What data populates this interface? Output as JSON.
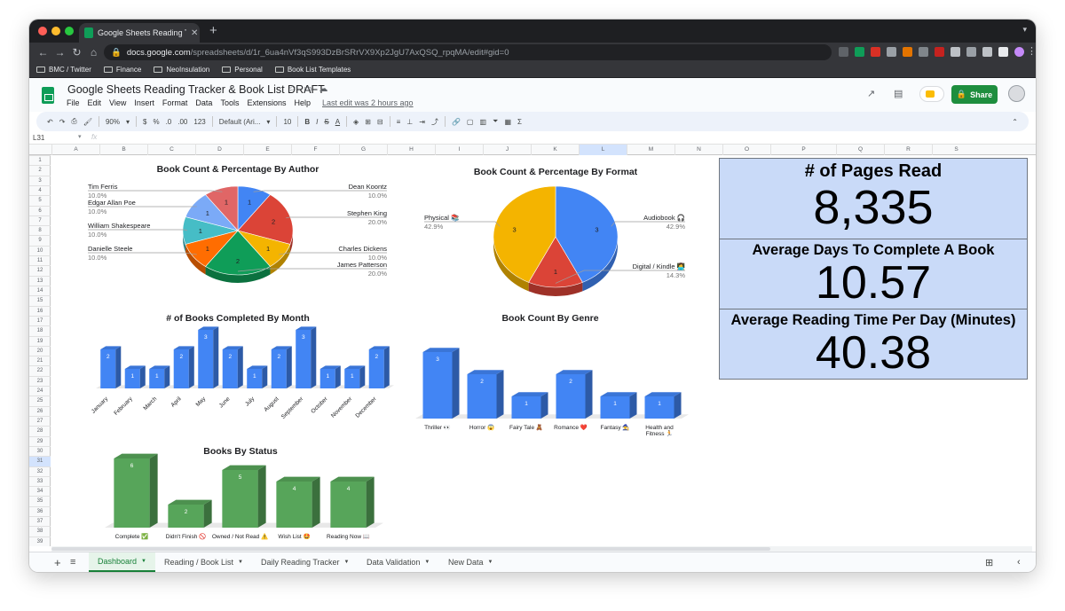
{
  "browser": {
    "tab_title": "Google Sheets Reading Tracker",
    "url_host": "docs.google.com",
    "url_path": "/spreadsheets/d/1r_6ua4nVf3qS993DzBrSRrVX9Xp2JgU7AxQSQ_rpqMA/edit#gid=0",
    "bookmarks": [
      "BMC / Twitter",
      "Finance",
      "NeoInsulation",
      "Personal",
      "Book List Templates"
    ]
  },
  "doc": {
    "title": "Google Sheets Reading Tracker & Book List DRAFT",
    "menus": [
      "File",
      "Edit",
      "View",
      "Insert",
      "Format",
      "Data",
      "Tools",
      "Extensions",
      "Help"
    ],
    "last_edit": "Last edit was 2 hours ago",
    "share_label": "Share"
  },
  "toolbar": {
    "zoom": "90%",
    "currency": "$",
    "percent": "%",
    "dec_decrease": ".0",
    "dec_increase": ".00",
    "format_more": "123",
    "font": "Default (Ari...",
    "font_size": "10"
  },
  "formula_bar": {
    "cell": "L31",
    "fx": "fx"
  },
  "columns": [
    "A",
    "B",
    "C",
    "D",
    "E",
    "F",
    "G",
    "H",
    "I",
    "J",
    "K",
    "L",
    "M",
    "N",
    "O",
    "P",
    "Q",
    "R",
    "S"
  ],
  "rows": [
    "1",
    "2",
    "3",
    "4",
    "5",
    "6",
    "7",
    "8",
    "9",
    "10",
    "11",
    "12",
    "13",
    "14",
    "15",
    "16",
    "17",
    "18",
    "19",
    "20",
    "21",
    "22",
    "23",
    "24",
    "25",
    "26",
    "27",
    "28",
    "29",
    "30",
    "31",
    "32",
    "33",
    "34",
    "35",
    "36",
    "37",
    "38",
    "39"
  ],
  "kpis": [
    {
      "label": "# of Pages Read",
      "value": "8,335"
    },
    {
      "label": "Average Days To Complete A Book",
      "value": "10.57"
    },
    {
      "label": "Average Reading Time Per Day (Minutes)",
      "value": "40.38"
    }
  ],
  "sheet_tabs": [
    "Dashboard",
    "Reading / Book List",
    "Daily Reading Tracker",
    "Data Validation",
    "New Data"
  ],
  "colors": {
    "blue": "#4285f4",
    "red": "#db4437",
    "yellow": "#f4b400",
    "green": "#0f9d58",
    "bar_green": "#57a55a",
    "kpi_bg": "#c9daf8",
    "share_green": "#1e8e3e"
  },
  "chart_data": [
    {
      "type": "pie",
      "title": "Book Count & Percentage By Author",
      "labels": [
        "Dean Koontz",
        "Stephen King",
        "Charles Dickens",
        "James Patterson",
        "Danielle Steele",
        "William Shakespeare",
        "Edgar Allan Poe",
        "Tim Ferris"
      ],
      "values": [
        1,
        2,
        1,
        2,
        1,
        1,
        1,
        1
      ],
      "percent_labels": [
        "10.0%",
        "20.0%",
        "10.0%",
        "20.0%",
        "10.0%",
        "10.0%",
        "10.0%",
        "10.0%"
      ],
      "colors": [
        "#4285f4",
        "#db4437",
        "#f4b400",
        "#0f9d58",
        "#ff6d01",
        "#46bdc6",
        "#7baaf7",
        "#e06666"
      ]
    },
    {
      "type": "pie",
      "title": "Book Count & Percentage By Format",
      "labels": [
        "Audiobook 🎧",
        "Digital / Kindle 👩‍💻",
        "Physical 📚"
      ],
      "values": [
        3,
        1,
        3
      ],
      "percent_labels": [
        "42.9%",
        "14.3%",
        "42.9%"
      ],
      "colors": [
        "#4285f4",
        "#db4437",
        "#f4b400"
      ]
    },
    {
      "type": "bar",
      "title": "# of Books Completed By Month",
      "categories": [
        "January",
        "February",
        "March",
        "April",
        "May",
        "June",
        "July",
        "August",
        "September",
        "October",
        "November",
        "December"
      ],
      "values": [
        2,
        1,
        1,
        2,
        3,
        2,
        1,
        2,
        3,
        1,
        1,
        2
      ],
      "color": "#4285f4"
    },
    {
      "type": "bar",
      "title": "Book Count By Genre",
      "categories": [
        "Thriller 👀",
        "Horror 😱",
        "Fairy Tale 🧸",
        "Romance ❤️",
        "Fantasy 🧙",
        "Health and Fitness 🏃"
      ],
      "values": [
        3,
        2,
        1,
        2,
        1,
        1
      ],
      "color": "#4285f4"
    },
    {
      "type": "bar",
      "title": "Books By Status",
      "categories": [
        "Complete ✅",
        "Didn't Finish 🚫",
        "Owned / Not Read ⚠️",
        "Wish List 🤩",
        "Reading Now 📖"
      ],
      "values": [
        6,
        2,
        5,
        4,
        4
      ],
      "color": "#57a55a"
    }
  ]
}
